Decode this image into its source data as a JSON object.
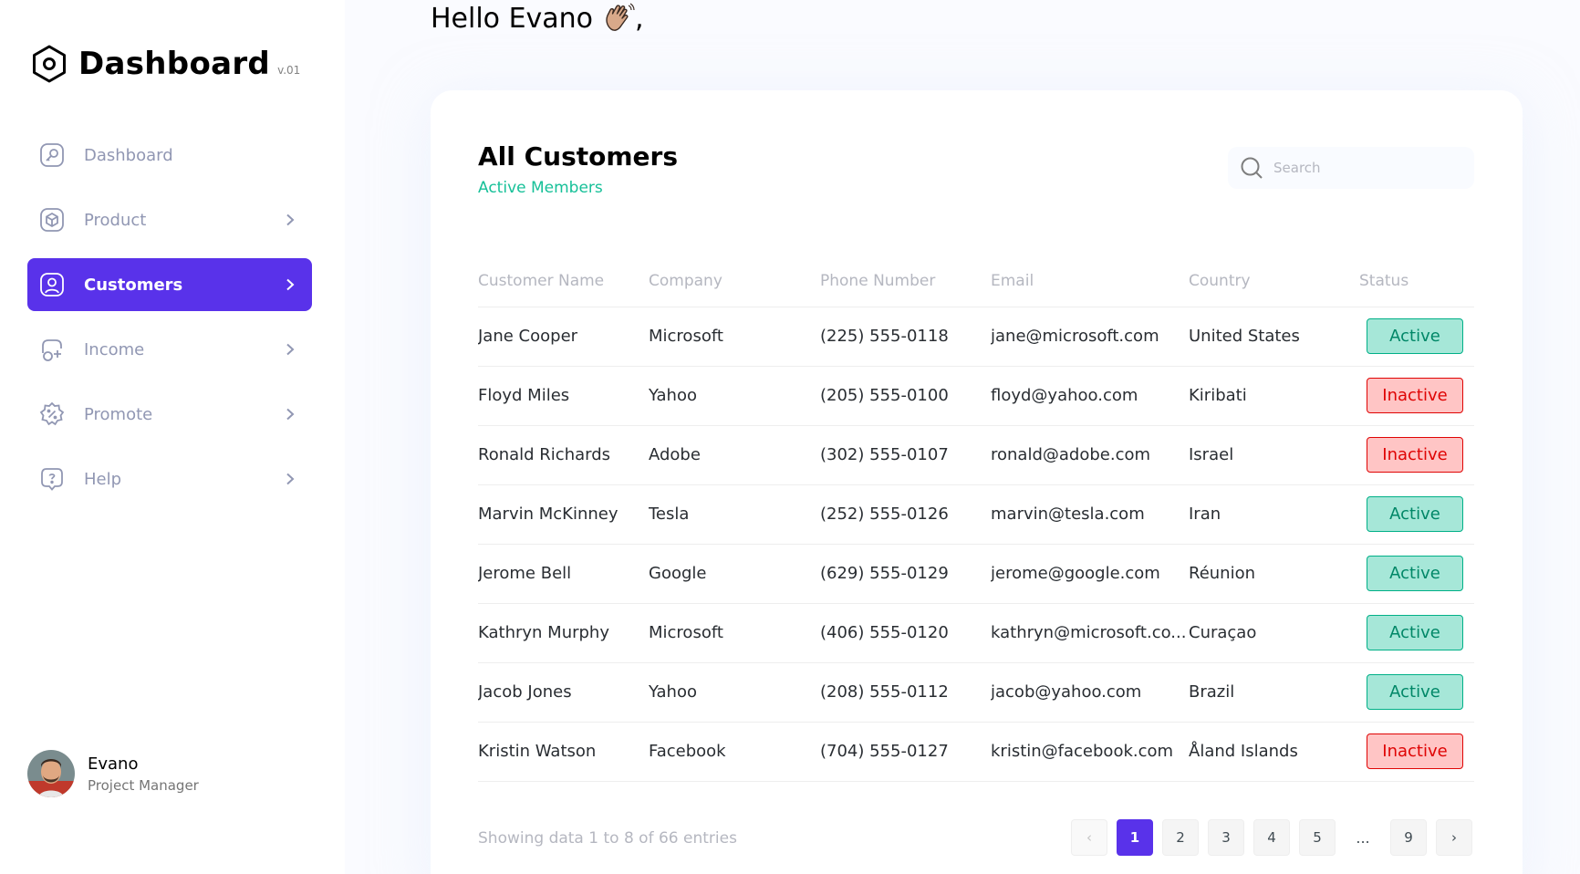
{
  "brand": {
    "title": "Dashboard",
    "version": "v.01"
  },
  "sidebar": {
    "items": [
      {
        "label": "Dashboard",
        "icon": "key-square-icon",
        "has_chevron": false,
        "active": false
      },
      {
        "label": "Product",
        "icon": "cube-icon",
        "has_chevron": true,
        "active": false
      },
      {
        "label": "Customers",
        "icon": "user-square-icon",
        "has_chevron": true,
        "active": true
      },
      {
        "label": "Income",
        "icon": "wallet-money-icon",
        "has_chevron": true,
        "active": false
      },
      {
        "label": "Promote",
        "icon": "discount-shape-icon",
        "has_chevron": true,
        "active": false
      },
      {
        "label": "Help",
        "icon": "message-question-icon",
        "has_chevron": true,
        "active": false
      }
    ]
  },
  "profile": {
    "name": "Evano",
    "role": "Project Manager"
  },
  "greeting": {
    "text": "Hello Evano",
    "suffix": ","
  },
  "customers": {
    "title": "All Customers",
    "subtitle": "Active Members",
    "search_placeholder": "Search",
    "columns": [
      "Customer Name",
      "Company",
      "Phone Number",
      "Email",
      "Country",
      "Status"
    ],
    "rows": [
      {
        "name": "Jane Cooper",
        "company": "Microsoft",
        "phone": "(225) 555-0118",
        "email": "jane@microsoft.com",
        "country": "United States",
        "status": "Active"
      },
      {
        "name": "Floyd Miles",
        "company": "Yahoo",
        "phone": "(205) 555-0100",
        "email": "floyd@yahoo.com",
        "country": "Kiribati",
        "status": "Inactive"
      },
      {
        "name": "Ronald Richards",
        "company": "Adobe",
        "phone": "(302) 555-0107",
        "email": "ronald@adobe.com",
        "country": "Israel",
        "status": "Inactive"
      },
      {
        "name": "Marvin McKinney",
        "company": "Tesla",
        "phone": "(252) 555-0126",
        "email": "marvin@tesla.com",
        "country": "Iran",
        "status": "Active"
      },
      {
        "name": "Jerome Bell",
        "company": "Google",
        "phone": "(629) 555-0129",
        "email": "jerome@google.com",
        "country": "Réunion",
        "status": "Active"
      },
      {
        "name": "Kathryn Murphy",
        "company": "Microsoft",
        "phone": "(406) 555-0120",
        "email": "kathryn@microsoft.co...",
        "country": "Curaçao",
        "status": "Active"
      },
      {
        "name": "Jacob Jones",
        "company": "Yahoo",
        "phone": "(208) 555-0112",
        "email": "jacob@yahoo.com",
        "country": "Brazil",
        "status": "Active"
      },
      {
        "name": "Kristin Watson",
        "company": "Facebook",
        "phone": "(704) 555-0127",
        "email": "kristin@facebook.com",
        "country": "Åland Islands",
        "status": "Inactive"
      }
    ],
    "footer": "Showing data 1 to 8 of 66 entries",
    "pagination": {
      "prev": "‹",
      "pages": [
        "1",
        "2",
        "3",
        "4",
        "5"
      ],
      "ellipsis": "...",
      "last": "9",
      "next": "›",
      "current": "1"
    }
  },
  "colors": {
    "accent": "#5932EA",
    "active_text": "#008767",
    "active_bg": "#A6E7D8",
    "inactive_text": "#DF0404",
    "inactive_bg": "#FFC5C5",
    "subtitle": "#16C098"
  }
}
